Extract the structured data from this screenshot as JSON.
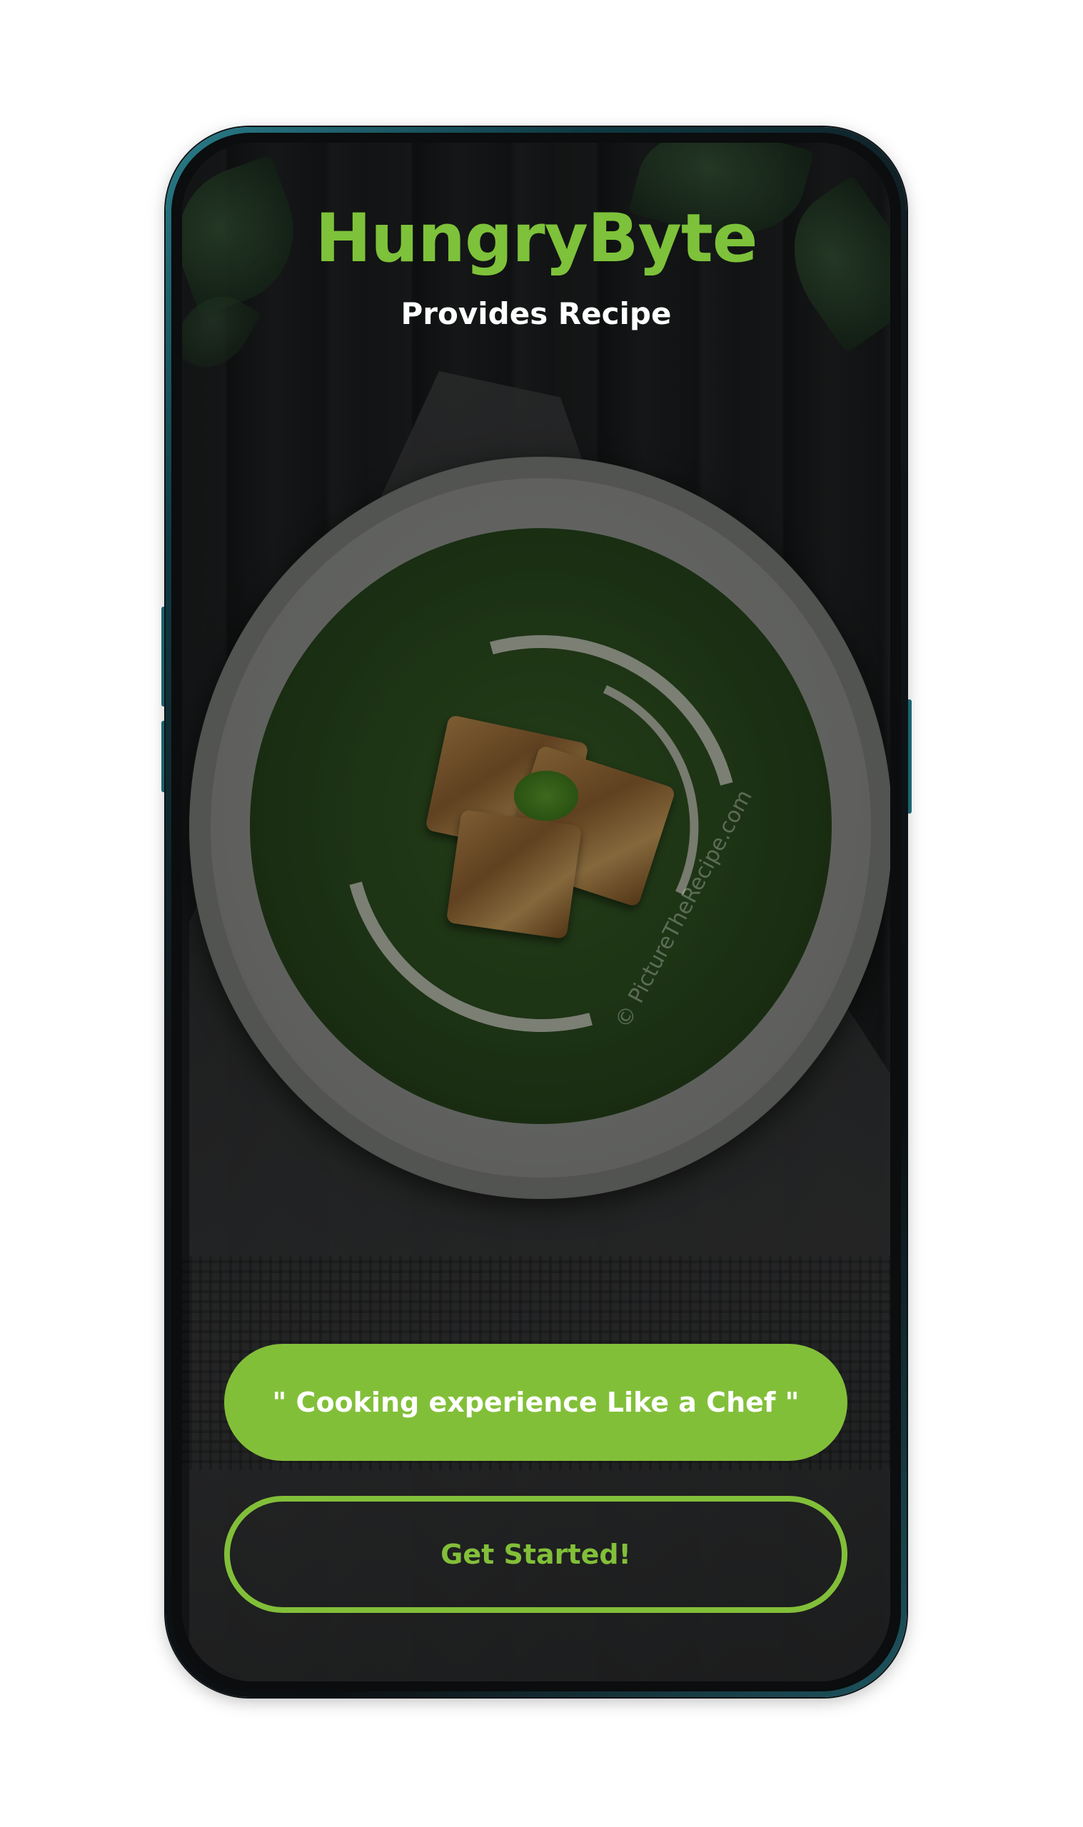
{
  "app": {
    "title": "HungryByte",
    "subtitle": "Provides Recipe"
  },
  "hero": {
    "watermark": "© PictureTheRecipe.com"
  },
  "tagline": {
    "label": "\" Cooking experience Like a Chef \""
  },
  "cta": {
    "label": "Get Started!"
  },
  "colors": {
    "accent": "#82bf39",
    "title": "#7dc23a",
    "text_on_accent": "#ffffff"
  },
  "icons": []
}
